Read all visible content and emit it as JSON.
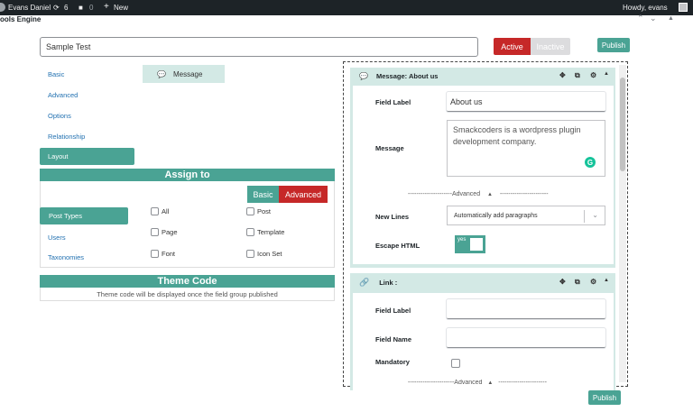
{
  "adminbar": {
    "site_name": "Evans Daniel",
    "updates_count": "6",
    "comments_count": "0",
    "new_label": "New",
    "howdy": "Howdy, evans"
  },
  "header": {
    "plugin_title": "ools Engine"
  },
  "form": {
    "title_value": "Sample Test",
    "active_label": "Active",
    "inactive_label": "Inactive",
    "publish_label": "Publish"
  },
  "left_nav": {
    "items": [
      "Basic",
      "Advanced",
      "Options",
      "Relationship",
      "Layout"
    ]
  },
  "field_chip": {
    "label": "Message"
  },
  "assign_to": {
    "title": "Assign to",
    "basic_label": "Basic",
    "advanced_label": "Advanced",
    "tabs": [
      "Post Types",
      "Users",
      "Taxonomies"
    ],
    "options": [
      "All",
      "Post",
      "Page",
      "Template",
      "Font",
      "Icon Set"
    ]
  },
  "theme_code": {
    "title": "Theme Code",
    "note": "Theme code will be displayed once the field group published"
  },
  "card_message": {
    "title": "Message: About us",
    "field_label_label": "Field Label",
    "field_label_value": "About us",
    "message_label": "Message",
    "message_value": "Smackcoders is a wordpress plugin development company.",
    "advanced_divider": "---------------------Advanced",
    "advanced_divider_tail": "-----------------------",
    "new_lines_label": "New Lines",
    "new_lines_value": "Automatically add paragraphs",
    "escape_html_label": "Escape HTML",
    "escape_html_state": "yes"
  },
  "card_link": {
    "title": "Link :",
    "field_label_label": "Field Label",
    "field_name_label": "Field Name",
    "mandatory_label": "Mandatory",
    "advanced_divider": "----------------------Advanced",
    "advanced_divider_tail": "-----------------------"
  },
  "colors": {
    "teal": "#4aa394",
    "teal_light": "#d3e9e5",
    "red": "#c62828"
  }
}
